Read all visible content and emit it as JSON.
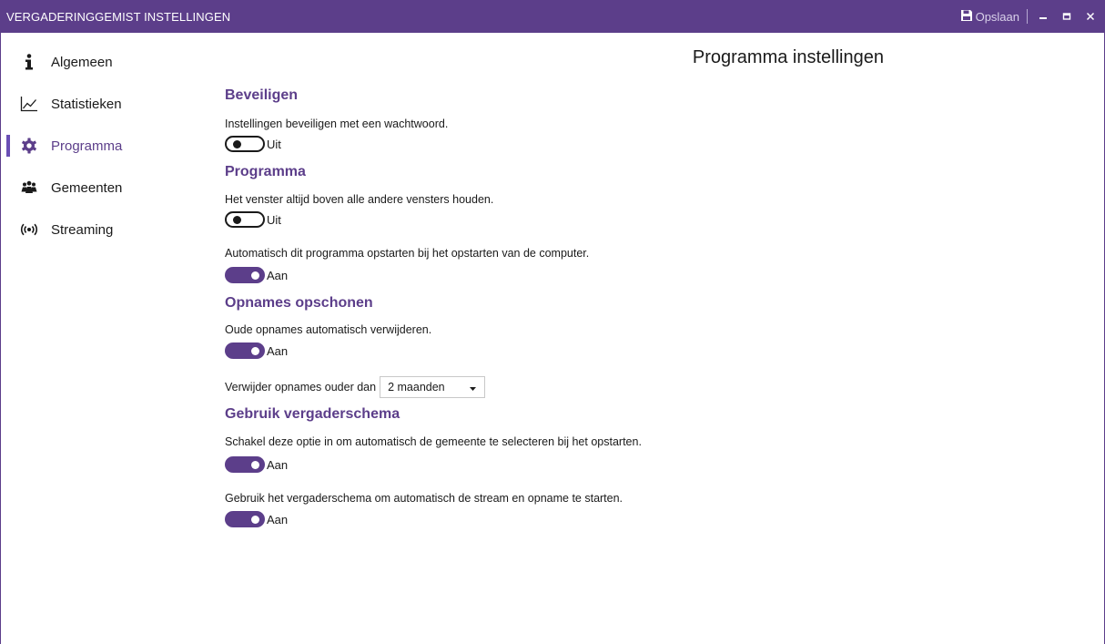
{
  "window": {
    "title": "VERGADERINGGEMIST INSTELLINGEN",
    "save_label": "Opslaan",
    "accent_color": "#5c3e8a"
  },
  "sidebar": {
    "items": [
      {
        "label": "Algemeen",
        "icon": "info-icon",
        "active": false
      },
      {
        "label": "Statistieken",
        "icon": "line-chart-icon",
        "active": false
      },
      {
        "label": "Programma",
        "icon": "gear-icon",
        "active": true
      },
      {
        "label": "Gemeenten",
        "icon": "group-icon",
        "active": false
      },
      {
        "label": "Streaming",
        "icon": "broadcast-icon",
        "active": false
      }
    ]
  },
  "main": {
    "page_title": "Programma instellingen",
    "sections": {
      "security": {
        "title": "Beveiligen",
        "settings": [
          {
            "description": "Instellingen beveiligen met een wachtwoord.",
            "state": "off",
            "state_label": "Uit"
          }
        ]
      },
      "program": {
        "title": "Programma",
        "settings": [
          {
            "description": "Het venster altijd boven alle andere vensters houden.",
            "state": "off",
            "state_label": "Uit"
          },
          {
            "description": "Automatisch dit programma opstarten bij het opstarten van de computer.",
            "state": "on",
            "state_label": "Aan"
          }
        ]
      },
      "cleanup": {
        "title": "Opnames opschonen",
        "settings": [
          {
            "description": "Oude opnames automatisch verwijderen.",
            "state": "on",
            "state_label": "Aan"
          }
        ],
        "retention_label": "Verwijder opnames ouder dan",
        "retention_value": "2 maanden"
      },
      "schedule": {
        "title": "Gebruik vergaderschema",
        "settings": [
          {
            "description": "Schakel deze optie in om automatisch de gemeente te selecteren bij het opstarten.",
            "state": "on",
            "state_label": "Aan"
          },
          {
            "description": "Gebruik het vergaderschema om automatisch de stream en opname te starten.",
            "state": "on",
            "state_label": "Aan"
          }
        ]
      }
    }
  }
}
